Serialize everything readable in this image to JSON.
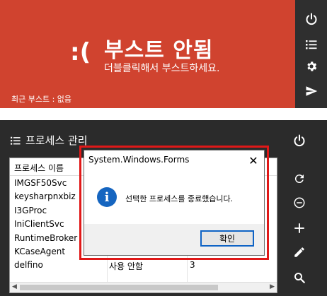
{
  "boost": {
    "face": ":(",
    "title": "부스트 안됨",
    "subtitle": "더블클릭해서 부스트하세요.",
    "recent": "최근 부스트 : 없음"
  },
  "top_sidebar": {
    "icons": [
      "power-icon",
      "list-icon",
      "gear-icon",
      "send-icon"
    ]
  },
  "process_manager": {
    "title": "프로세스 관리",
    "columns": [
      "프로세스 이름",
      "",
      ""
    ],
    "rows": [
      {
        "name": "IMGSF50Svc",
        "status": "",
        "count": ""
      },
      {
        "name": "keysharpnxbiz",
        "status": "",
        "count": ""
      },
      {
        "name": "I3GProc",
        "status": "",
        "count": ""
      },
      {
        "name": "IniClientSvc",
        "status": "",
        "count": ""
      },
      {
        "name": "RuntimeBroker",
        "status": "",
        "count": ""
      },
      {
        "name": "KCaseAgent",
        "status": "",
        "count": ""
      },
      {
        "name": "delfino",
        "status": "사용 안함",
        "count": "3"
      },
      {
        "name": "",
        "status": "",
        "count": ""
      }
    ],
    "side_icons": [
      "power-icon",
      "refresh-icon",
      "minus-icon",
      "plus-icon",
      "pencil-icon",
      "search-icon"
    ]
  },
  "dialog": {
    "title": "System.Windows.Forms",
    "message": "선택한 프로세스를 종료했습니다.",
    "ok_label": "확인",
    "close_glyph": "✕",
    "info_glyph": "i"
  },
  "colors": {
    "boost_bg": "#d0432f",
    "dark_bg": "#2b2b2b",
    "highlight": "#e01818",
    "info_icon": "#1565c0"
  }
}
